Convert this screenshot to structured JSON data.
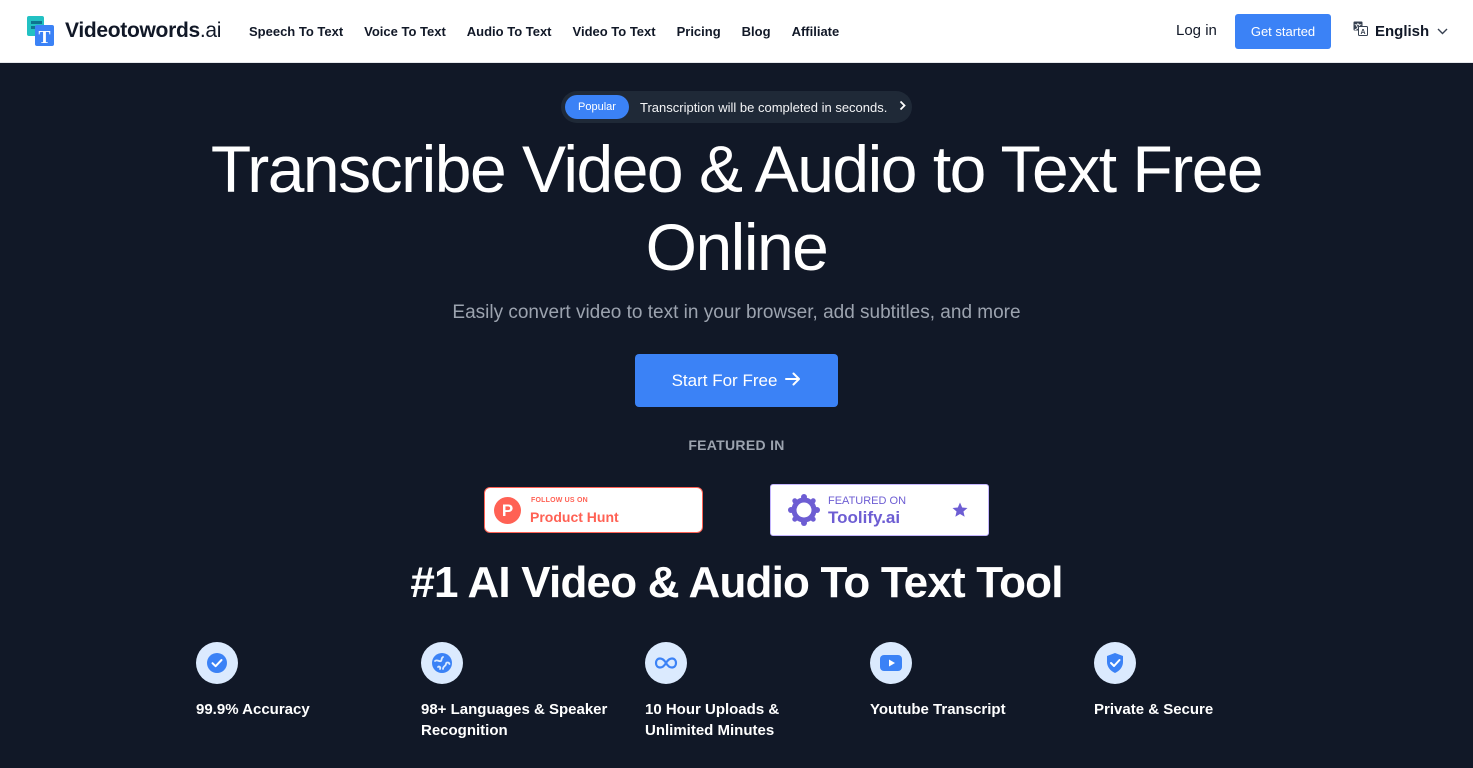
{
  "nav": {
    "logo_text": "Videotowords",
    "logo_suffix": ".ai",
    "links": [
      {
        "label": "Speech To Text"
      },
      {
        "label": "Voice To Text"
      },
      {
        "label": "Audio To Text"
      },
      {
        "label": "Video To Text"
      },
      {
        "label": "Pricing"
      },
      {
        "label": "Blog"
      },
      {
        "label": "Affiliate"
      }
    ],
    "login_label": "Log in",
    "get_started_label": "Get started",
    "language": "English"
  },
  "hero": {
    "pill_badge": "Popular",
    "pill_text": "Transcription will be completed in seconds.",
    "title_line1": "Transcribe Video & Audio to Text Free",
    "title_line2": "Online",
    "subtitle": "Easily convert video to text in your browser, add subtitles, and more",
    "cta_label": "Start For Free"
  },
  "featured": {
    "heading": "FEATURED IN",
    "producthunt": {
      "small": "FOLLOW US ON",
      "big": "Product Hunt",
      "letter": "P"
    },
    "toolify": {
      "small": "FEATURED ON",
      "big": "Toolify.ai"
    }
  },
  "section": {
    "title": "#1 AI Video & Audio To Text Tool",
    "features": [
      {
        "label": "99.9% Accuracy",
        "icon": "check-circle-icon"
      },
      {
        "label": "98+ Languages & Speaker Recognition",
        "icon": "globe-icon"
      },
      {
        "label": "10 Hour Uploads & Unlimited Minutes",
        "icon": "infinity-icon"
      },
      {
        "label": "Youtube Transcript",
        "icon": "youtube-icon"
      },
      {
        "label": "Private & Secure",
        "icon": "shield-check-icon"
      }
    ]
  },
  "colors": {
    "accent": "#3b82f6",
    "background": "#111827",
    "producthunt": "#ff6154",
    "toolify": "#6d5dd3"
  }
}
